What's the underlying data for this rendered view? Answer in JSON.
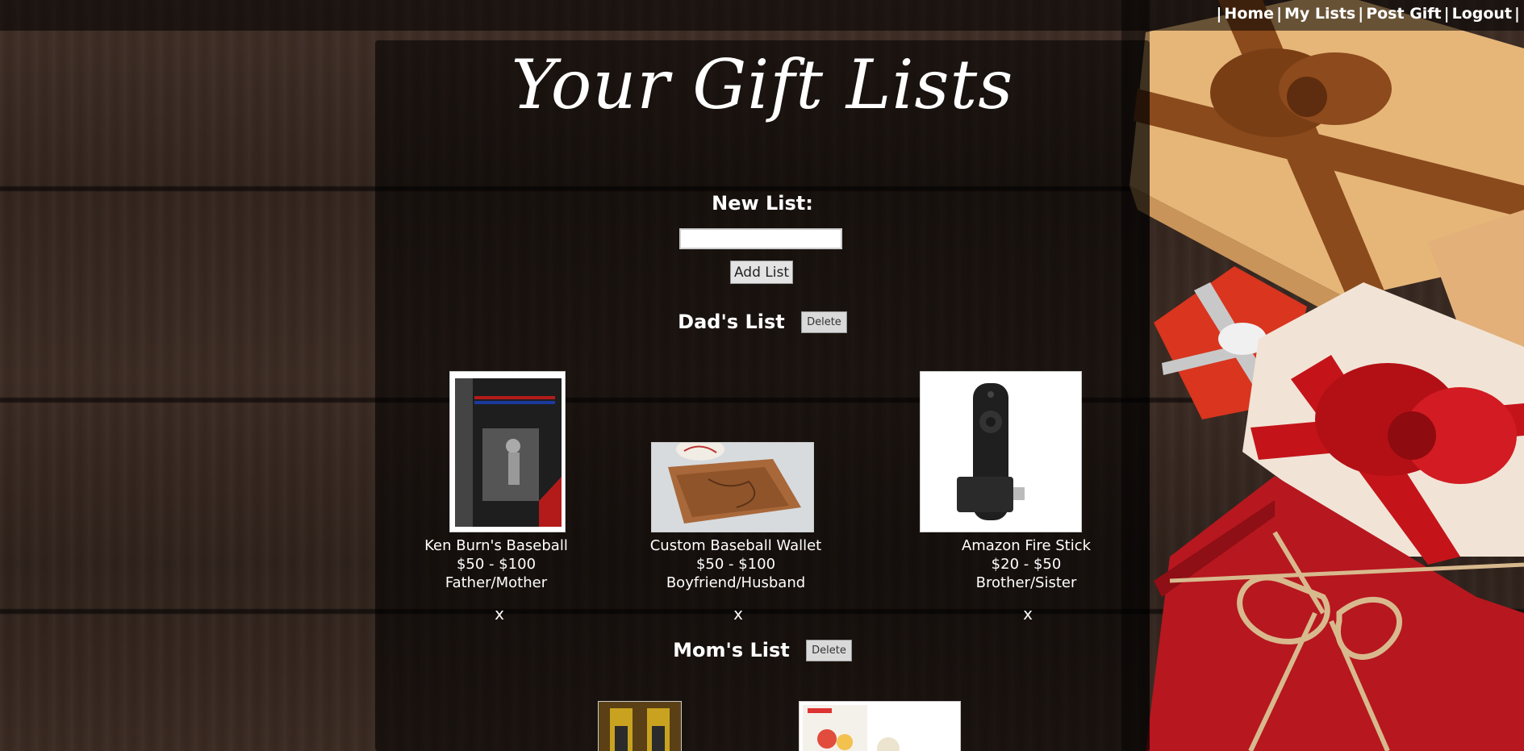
{
  "nav": {
    "items": [
      "Home",
      "My Lists",
      "Post Gift",
      "Logout"
    ]
  },
  "page": {
    "title": "Your Gift Lists",
    "new_list_label": "New List:",
    "new_list_value": "",
    "add_list_label": "Add List"
  },
  "lists": [
    {
      "name": "Dad's List",
      "delete_label": "Delete",
      "items": [
        {
          "name": "Ken Burn's Baseball",
          "price": "$50 - $100",
          "recipient": "Father/Mother",
          "remove": "x"
        },
        {
          "name": "Custom Baseball Wallet",
          "price": "$50 - $100",
          "recipient": "Boyfriend/Husband",
          "remove": "x"
        },
        {
          "name": "Amazon Fire Stick",
          "price": "$20 - $50",
          "recipient": "Brother/Sister",
          "remove": "x"
        }
      ]
    },
    {
      "name": "Mom's List",
      "delete_label": "Delete",
      "items": []
    }
  ],
  "colors": {
    "wood": "#3a2a22",
    "panel": "rgba(0,0,0,0.55)",
    "text": "#ffffff",
    "gift_red": "#c0202a",
    "gift_kraft": "#e8b978",
    "ribbon_brown": "#8a4a1c"
  },
  "icons": {
    "dvd_cover": "baseball-dvd-image",
    "wallet": "wallet-image",
    "remote": "fire-stick-image",
    "wine": "wine-bottles-image",
    "snack": "snack-box-image"
  }
}
